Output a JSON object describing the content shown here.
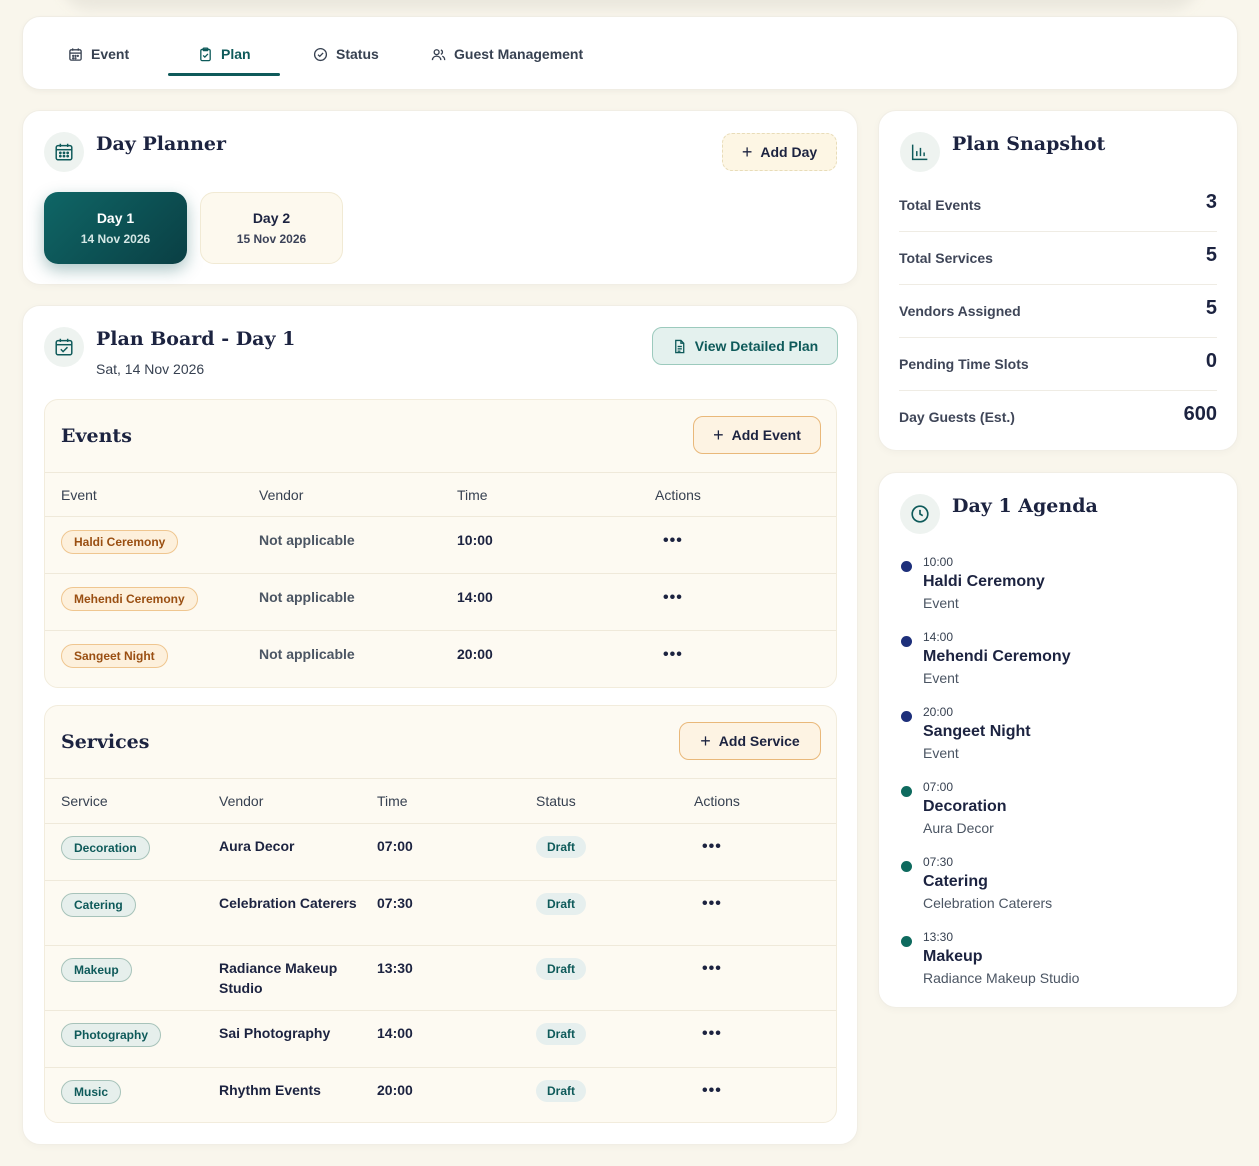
{
  "tabs": [
    {
      "label": "Event",
      "icon": "calendar-icon"
    },
    {
      "label": "Plan",
      "icon": "clipboard-check-icon",
      "active": true
    },
    {
      "label": "Status",
      "icon": "check-circle-icon"
    },
    {
      "label": "Guest Management",
      "icon": "users-icon"
    }
  ],
  "day_planner": {
    "title": "Day Planner",
    "add_day_label": "Add Day",
    "days": [
      {
        "label": "Day 1",
        "date": "14 Nov 2026",
        "active": true
      },
      {
        "label": "Day 2",
        "date": "15 Nov 2026",
        "active": false
      }
    ]
  },
  "plan_board": {
    "title": "Plan Board - Day 1",
    "subtitle": "Sat, 14 Nov 2026",
    "view_plan_label": "View Detailed Plan"
  },
  "events": {
    "title": "Events",
    "add_label": "Add Event",
    "columns": [
      "Event",
      "Vendor",
      "Time",
      "Actions"
    ],
    "rows": [
      {
        "name": "Haldi Ceremony",
        "vendor": "Not applicable",
        "time": "10:00",
        "actions": "•••"
      },
      {
        "name": "Mehendi Ceremony",
        "vendor": "Not applicable",
        "time": "14:00",
        "actions": "•••"
      },
      {
        "name": "Sangeet Night",
        "vendor": "Not applicable",
        "time": "20:00",
        "actions": "•••"
      }
    ]
  },
  "services": {
    "title": "Services",
    "add_label": "Add Service",
    "columns": [
      "Service",
      "Vendor",
      "Time",
      "Status",
      "Actions"
    ],
    "rows": [
      {
        "name": "Decoration",
        "vendor": "Aura Decor",
        "time": "07:00",
        "status": "Draft",
        "actions": "•••"
      },
      {
        "name": "Catering",
        "vendor": "Celebration Caterers",
        "time": "07:30",
        "status": "Draft",
        "actions": "•••"
      },
      {
        "name": "Makeup",
        "vendor": "Radiance Makeup Studio",
        "time": "13:30",
        "status": "Draft",
        "actions": "•••"
      },
      {
        "name": "Photography",
        "vendor": "Sai Photography",
        "time": "14:00",
        "status": "Draft",
        "actions": "•••"
      },
      {
        "name": "Music",
        "vendor": "Rhythm Events",
        "time": "20:00",
        "status": "Draft",
        "actions": "•••"
      }
    ]
  },
  "snapshot": {
    "title": "Plan Snapshot",
    "rows": [
      {
        "label": "Total Events",
        "value": "3"
      },
      {
        "label": "Total Services",
        "value": "5"
      },
      {
        "label": "Vendors Assigned",
        "value": "5"
      },
      {
        "label": "Pending Time Slots",
        "value": "0"
      },
      {
        "label": "Day Guests (Est.)",
        "value": "600"
      }
    ]
  },
  "agenda": {
    "title": "Day 1 Agenda",
    "items": [
      {
        "time": "10:00",
        "title": "Haldi Ceremony",
        "sub": "Event",
        "kind": "event"
      },
      {
        "time": "14:00",
        "title": "Mehendi Ceremony",
        "sub": "Event",
        "kind": "event"
      },
      {
        "time": "20:00",
        "title": "Sangeet Night",
        "sub": "Event",
        "kind": "event"
      },
      {
        "time": "07:00",
        "title": "Decoration",
        "sub": "Aura Decor",
        "kind": "service"
      },
      {
        "time": "07:30",
        "title": "Catering",
        "sub": "Celebration Caterers",
        "kind": "service"
      },
      {
        "time": "13:30",
        "title": "Makeup",
        "sub": "Radiance Makeup Studio",
        "kind": "service"
      }
    ]
  },
  "colors": {
    "accent_teal": "#0e5a5a",
    "event_dot": "#1d2f7a",
    "service_dot": "#0e6a5e",
    "background": "#f9f6ec"
  }
}
